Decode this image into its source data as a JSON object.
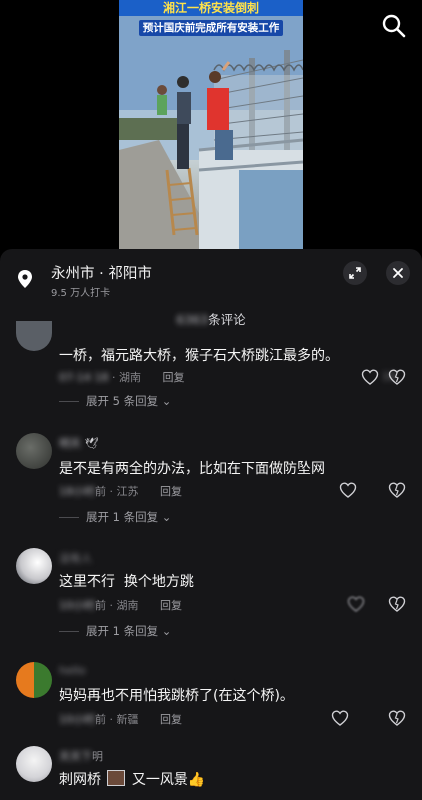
{
  "video": {
    "caption_line1": "湘江一桥安装倒刺",
    "caption_line2": "预计国庆前完成所有安装工作"
  },
  "location": {
    "title": "永州市 · 祁阳市",
    "subtitle": "9.5 万人打卡"
  },
  "comments_header": {
    "count_blurred": "6363",
    "label": "条评论"
  },
  "comments": [
    {
      "text": "一桥，福元路大桥，猴子石大桥跳江最多的。",
      "time_blurred": "07-14 18",
      "location": "湖南",
      "reply_label": "回复",
      "like_count_blurred": "16",
      "expand_label": "展开 5 条回复"
    },
    {
      "username_blurred": "明天",
      "text": "是不是有两全的办法，比如在下面做防坠网",
      "time_blurred": "18小时",
      "time_suffix": "前 · 江苏",
      "reply_label": "回复",
      "expand_label": "展开 1 条回复"
    },
    {
      "username_blurred": "没有人",
      "text": "这里不行  换个地方跳",
      "time_blurred": "10小时",
      "time_suffix": "前 · 湖南",
      "reply_label": "回复",
      "expand_label": "展开 1 条回复"
    },
    {
      "username_blurred": "hello",
      "text": "妈妈再也不用怕我跳桥了(在这个桥)。",
      "time_blurred": "10小时",
      "time_suffix": "前 · 新疆",
      "reply_label": "回复"
    },
    {
      "username_blurred": "天天下",
      "username_suffix": "明",
      "text_part1": "刺网桥",
      "text_part2": "又一风景",
      "emoji": "👍"
    }
  ],
  "colors": {
    "sheet_bg": "#161618",
    "caption_banner": "#1b60c8",
    "caption_text": "#ffe24a"
  }
}
